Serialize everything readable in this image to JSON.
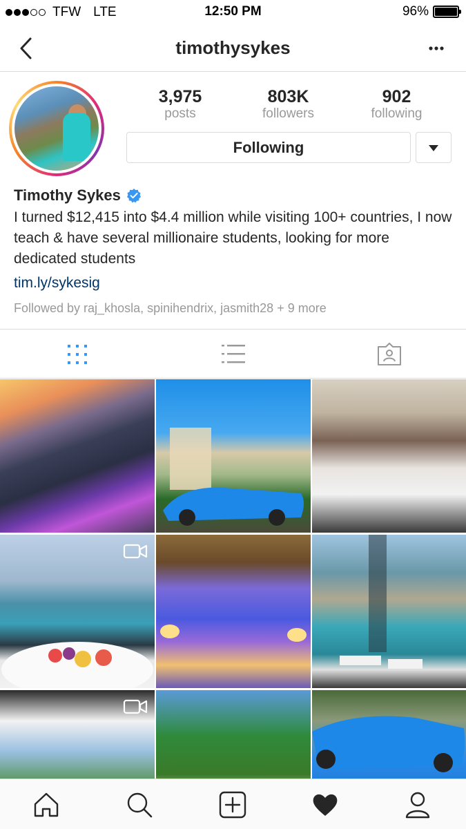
{
  "status_bar": {
    "carrier": "TFW",
    "network": "LTE",
    "time": "12:50 PM",
    "battery": "96%"
  },
  "nav": {
    "title": "timothysykes",
    "back_icon": "chevron-left-icon",
    "more_icon": "more-horizontal-icon"
  },
  "profile": {
    "stats": [
      {
        "value": "3,975",
        "label": "posts"
      },
      {
        "value": "803K",
        "label": "followers"
      },
      {
        "value": "902",
        "label": "following"
      }
    ],
    "following_button": "Following",
    "name": "Timothy Sykes",
    "verified": true,
    "bio": "I turned $12,415 into $4.4 million while visiting 100+ countries, I now teach & have several millionaire students, looking for more dedicated students",
    "link": "tim.ly/sykesig",
    "followed_by": "Followed by raj_khosla, spinihendrix, jasmith28 + 9 more"
  },
  "view_tabs": [
    "grid-icon",
    "list-icon",
    "tagged-icon"
  ],
  "grid": {
    "photos": [
      {
        "video": false
      },
      {
        "video": false
      },
      {
        "video": false
      },
      {
        "video": true
      },
      {
        "video": false
      },
      {
        "video": false
      },
      {
        "video": true
      },
      {
        "video": false
      },
      {
        "video": false
      }
    ]
  },
  "tab_bar": [
    "home-icon",
    "search-icon",
    "add-post-icon",
    "activity-heart-icon",
    "profile-icon"
  ],
  "colors": {
    "link": "#003569",
    "verified": "#3897f0",
    "active_tab": "#3897f0",
    "border": "#dbdbdb",
    "muted": "#999999"
  }
}
